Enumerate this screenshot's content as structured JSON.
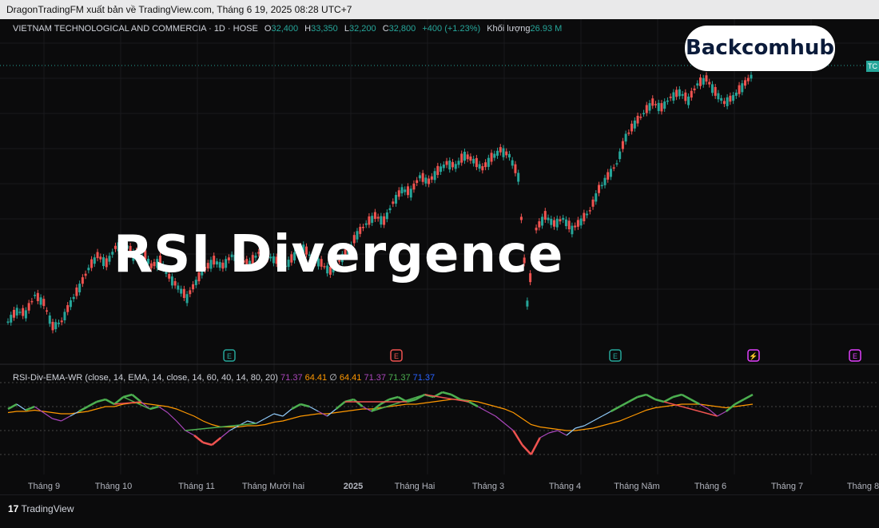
{
  "header": {
    "publisher_line": "DragonTradingFM xuất bản về TradingView.com, Tháng 6 19, 2025 08:28 UTC+7"
  },
  "legend": {
    "symbol": "VIETNAM TECHNOLOGICAL AND COMMERCIA · 1D · HOSE",
    "o_label": "O",
    "o_value": "32,400",
    "h_label": "H",
    "h_value": "33,350",
    "l_label": "L",
    "l_value": "32,200",
    "c_label": "C",
    "c_value": "32,800",
    "change": "+400 (+1.23%)",
    "volume_label": "Khối lượng",
    "volume_value": "26.93 M"
  },
  "indicator": {
    "name": "RSI-Div-EMA-WR (close, 14, EMA, 14, close, 14, 60, 40, 14, 80, 20)",
    "values": [
      "71.37",
      "64.41",
      "∅",
      "64.41",
      "71.37",
      "71.37",
      "71.37"
    ],
    "value_colors": [
      "#ab47bc",
      "#ff9800",
      "#d1d4dc",
      "#ff9800",
      "#ab47bc",
      "#4caf50",
      "#2962ff"
    ]
  },
  "brand": {
    "logo_text": "Backcomhub"
  },
  "overlay_title": "RSI Divergence",
  "price_tag": "TC",
  "footer": {
    "tradingview": "TradingView"
  },
  "chart_data": {
    "type": "candlestick",
    "x_ticks": [
      "Tháng 9",
      "Tháng 10",
      "Tháng 11",
      "Tháng Mười hai",
      "2025",
      "Tháng Hai",
      "Tháng 3",
      "Tháng 4",
      "Tháng Năm",
      "Tháng 6",
      "Tháng 7",
      "Tháng 8"
    ],
    "event_markers": [
      {
        "at": "Tháng 11",
        "label": "E",
        "color": "#26a69a"
      },
      {
        "at": "Tháng Hai",
        "label": "E",
        "color": "#ef5350"
      },
      {
        "at": "Tháng Năm",
        "label": "E",
        "color": "#26a69a"
      },
      {
        "at": "Tháng 6",
        "label": "⚡",
        "color": "#e040fb"
      },
      {
        "at": "Tháng 7",
        "label": "E",
        "color": "#e040fb"
      }
    ],
    "close_path": [
      0.05,
      0.09,
      0.08,
      0.15,
      0.12,
      0.03,
      0.05,
      0.12,
      0.18,
      0.25,
      0.3,
      0.27,
      0.33,
      0.35,
      0.3,
      0.32,
      0.26,
      0.28,
      0.22,
      0.18,
      0.14,
      0.2,
      0.25,
      0.28,
      0.26,
      0.3,
      0.28,
      0.27,
      0.31,
      0.3,
      0.28,
      0.26,
      0.3,
      0.33,
      0.29,
      0.27,
      0.24,
      0.28,
      0.32,
      0.38,
      0.42,
      0.45,
      0.43,
      0.5,
      0.55,
      0.54,
      0.6,
      0.58,
      0.62,
      0.65,
      0.64,
      0.68,
      0.66,
      0.63,
      0.67,
      0.7,
      0.68,
      0.6,
      0.12,
      0.4,
      0.45,
      0.42,
      0.44,
      0.4,
      0.43,
      0.47,
      0.55,
      0.6,
      0.65,
      0.75,
      0.8,
      0.84,
      0.88,
      0.86,
      0.9,
      0.92,
      0.89,
      0.95,
      0.97,
      0.92,
      0.88,
      0.9,
      0.94,
      0.98
    ],
    "rsi": [
      58,
      62,
      57,
      60,
      55,
      50,
      48,
      52,
      56,
      60,
      64,
      66,
      62,
      68,
      70,
      64,
      58,
      60,
      55,
      48,
      40,
      36,
      30,
      28,
      34,
      40,
      44,
      48,
      46,
      50,
      54,
      52,
      58,
      62,
      60,
      56,
      52,
      58,
      64,
      66,
      60,
      56,
      62,
      66,
      68,
      64,
      66,
      70,
      68,
      72,
      70,
      66,
      64,
      60,
      56,
      52,
      46,
      40,
      28,
      20,
      34,
      38,
      40,
      36,
      42,
      44,
      48,
      52,
      56,
      60,
      64,
      68,
      70,
      66,
      64,
      68,
      70,
      66,
      62,
      58,
      52,
      56,
      62,
      66,
      70
    ],
    "rsi_ema": [
      55,
      56,
      56,
      57,
      56,
      55,
      54,
      54,
      55,
      56,
      58,
      60,
      60,
      62,
      63,
      63,
      62,
      61,
      60,
      58,
      55,
      52,
      48,
      45,
      43,
      43,
      43,
      44,
      44,
      45,
      47,
      48,
      50,
      52,
      53,
      54,
      54,
      55,
      56,
      57,
      58,
      58,
      59,
      60,
      61,
      62,
      62,
      63,
      64,
      65,
      66,
      66,
      65,
      64,
      62,
      60,
      58,
      55,
      50,
      45,
      43,
      42,
      41,
      40,
      40,
      41,
      42,
      44,
      46,
      48,
      51,
      54,
      57,
      59,
      60,
      61,
      62,
      62,
      62,
      61,
      60,
      59,
      60,
      61,
      62
    ],
    "divergences": [
      {
        "type": "bullish",
        "color": "#4caf50"
      },
      {
        "type": "bearish",
        "color": "#ef5350"
      }
    ]
  }
}
